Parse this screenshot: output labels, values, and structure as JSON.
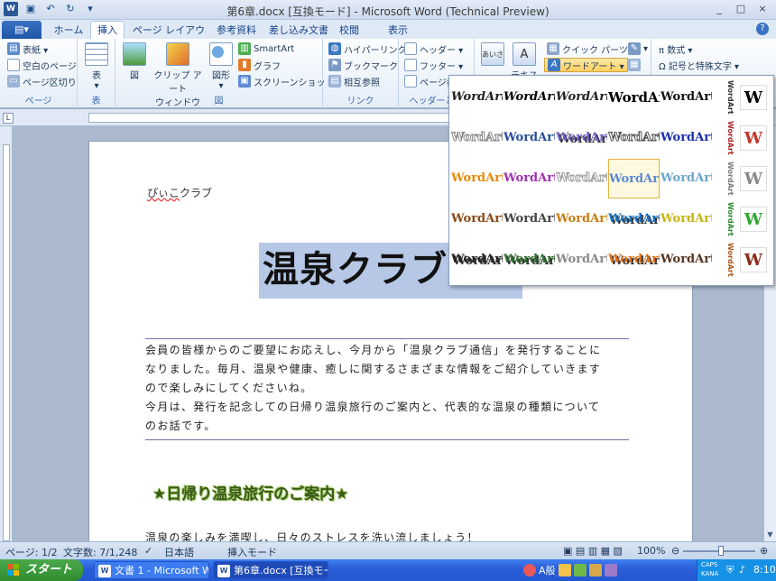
{
  "window": {
    "title": "第6章.docx [互換モード] - Microsoft Word (Technical Preview)",
    "logo": "W",
    "controls": [
      "_",
      "□",
      "×"
    ]
  },
  "qat": {
    "save_icon": "save-icon",
    "undo": "↶",
    "redo": "↻",
    "customize": "▾"
  },
  "tabs": {
    "file": "ファイル",
    "items": [
      "ホーム",
      "挿入",
      "ページ レイアウト",
      "参考資料",
      "差し込み文書",
      "校閲",
      "表示"
    ],
    "active": "挿入"
  },
  "ribbon": {
    "pages": {
      "cover": "表紙 ▾",
      "blank": "空白のページ",
      "break": "ページ区切り",
      "label": "ページ"
    },
    "table": {
      "button": "表",
      "label": "表"
    },
    "illustrations": {
      "picture": "図",
      "clipart": "クリップ アート",
      "clipart2": "ウィンドウ",
      "shapes": "図形",
      "smartart": "SmartArt",
      "chart": "グラフ",
      "screenshot": "スクリーンショット ▾",
      "label": "図"
    },
    "links": {
      "hyperlink": "ハイパーリンク",
      "bookmark": "ブックマーク",
      "crossref": "相互参照",
      "label": "リンク"
    },
    "header": {
      "header": "ヘッダー ▾",
      "footer": "フッター ▾",
      "pagenum": "ページ番",
      "label": "ヘッダーとフ"
    },
    "text": {
      "greeting": "あいさつ",
      "textbox": "テキスト",
      "quickparts": "クイック パーツ ▾",
      "wordart": "ワードアート ▾",
      "sig": "▾"
    },
    "symbols": {
      "equation": "π 数式 ▾",
      "symbol": "Ω 記号と特殊文字 ▾"
    }
  },
  "document": {
    "club_name": "ぴぃこ",
    "club_name_rest": "クラブ",
    "title": "温泉クラブ通信",
    "intro_lines": [
      "会員の皆様からのご要望にお応えし、今月から「温泉クラブ通信」を発行することに",
      "なりました。毎月、温泉や健康、癒しに関するさまざまな情報をご紹介していきます",
      "ので楽しみにしてくださいね。",
      "今月は、発行を記念しての日帰り温泉旅行のご案内と、代表的な温泉の種類について",
      "のお話です。"
    ],
    "section_title": "★日帰り温泉旅行のご案内★",
    "next_line": "温泉の楽しみを満喫し、日々のストレスを洗い流しましょう！"
  },
  "wordart_gallery": {
    "sample": "WordArt",
    "selected_index": 13,
    "styles": [
      {
        "color": "#222222",
        "style": "italic"
      },
      {
        "color": "#000000",
        "style": "bold-italic"
      },
      {
        "color": "#222222",
        "style": "wave"
      },
      {
        "color": "#000000",
        "style": "wide"
      },
      {
        "color": "#111111",
        "style": "plain"
      },
      {
        "color": "#888888",
        "style": "outline"
      },
      {
        "color": "#2a4d9a",
        "style": "plain"
      },
      {
        "color": "#6b5fbf",
        "style": "shadow"
      },
      {
        "color": "#555555",
        "style": "thin"
      },
      {
        "color": "#1b2fa8",
        "style": "gradient"
      },
      {
        "color": "#e58a0a",
        "style": "orange"
      },
      {
        "color": "#a02fb0",
        "style": "purple"
      },
      {
        "color": "#9aa19a",
        "style": "silver"
      },
      {
        "color": "#5b8ad0",
        "style": "rainbow"
      },
      {
        "color": "#6aa7c8",
        "style": "teal"
      },
      {
        "color": "#8a4b1a",
        "style": "brown"
      },
      {
        "color": "#444444",
        "style": "grey"
      },
      {
        "color": "#c77c10",
        "style": "gold"
      },
      {
        "color": "#1673c8",
        "style": "blue-3d"
      },
      {
        "color": "#c7b512",
        "style": "yellow"
      },
      {
        "color": "#222222",
        "style": "shadow-dark"
      },
      {
        "color": "#2b6e2b",
        "style": "green-3d"
      },
      {
        "color": "#888888",
        "style": "curved"
      },
      {
        "color": "#e07015",
        "style": "orange-3d"
      },
      {
        "color": "#553322",
        "style": "dark"
      }
    ],
    "side_letter": "W",
    "side_colors": [
      "#000000",
      "#c0392b",
      "#888888",
      "#2ea82e",
      "#8b2b1a"
    ],
    "vertical_colors": [
      "#333333",
      "#aa2222",
      "#777777",
      "#2a8a2a",
      "#b0551a"
    ]
  },
  "status": {
    "page": "ページ: 1/2",
    "words": "文字数: 7/1,248",
    "lang": "日本語",
    "mode": "挿入モード",
    "zoom": "100%",
    "zoom_level": 0.5
  },
  "taskbar": {
    "start": "スタート",
    "tasks": [
      "文書 1 - Microsoft W...",
      "第6章.docx [互換モー..."
    ],
    "active_task": 1,
    "ime": "A般",
    "tray_caps": "CAPS",
    "tray_kana": "KANA",
    "clock": "8:10"
  }
}
